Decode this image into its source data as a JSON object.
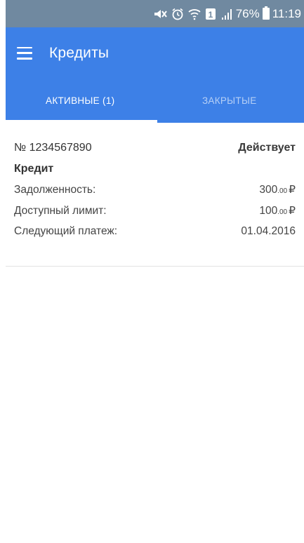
{
  "status_bar": {
    "battery": "76%",
    "time": "11:19",
    "sim": "1",
    "icons": [
      "mute-icon",
      "alarm-icon",
      "wifi-icon",
      "sim-icon",
      "signal-icon",
      "battery-icon"
    ]
  },
  "header": {
    "title": "Кредиты",
    "background_color": "#3d80e7"
  },
  "tabs": [
    {
      "label": "АКТИВНЫЕ (1)",
      "active": true
    },
    {
      "label": "ЗАКРЫТЫЕ",
      "active": false
    }
  ],
  "credits": [
    {
      "number": "№ 1234567890",
      "status": "Действует",
      "type": "Кредит",
      "debt_label": "Задолженность:",
      "debt_int": "300",
      "debt_cents": ".00",
      "debt_currency": "₽",
      "limit_label": "Доступный лимит:",
      "limit_int": "100",
      "limit_cents": ".00",
      "limit_currency": "₽",
      "next_payment_label": "Следующий платеж:",
      "next_payment_date": "01.04.2016"
    }
  ]
}
